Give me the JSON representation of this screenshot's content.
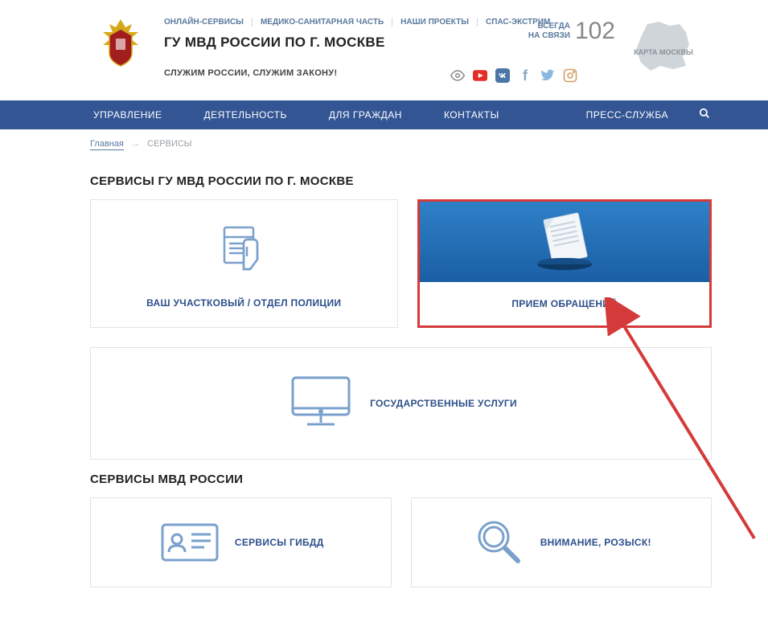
{
  "header": {
    "topnav": [
      "ОНЛАЙН-СЕРВИСЫ",
      "МЕДИКО-САНИТАРНАЯ ЧАСТЬ",
      "НАШИ ПРОЕКТЫ",
      "СПАС-ЭКСТРИМ"
    ],
    "title": "ГУ МВД РОССИИ ПО Г. МОСКВЕ",
    "slogan": "СЛУЖИМ РОССИИ, СЛУЖИМ ЗАКОНУ!",
    "phone_top": "ВСЕГДА",
    "phone_bot": "НА СВЯЗИ",
    "phone": "102",
    "map_caption": "КАРТА МОСКВЫ"
  },
  "nav": [
    "УПРАВЛЕНИЕ",
    "ДЕЯТЕЛЬНОСТЬ",
    "ДЛЯ ГРАЖДАН",
    "КОНТАКТЫ",
    "ПРЕСС-СЛУЖБА"
  ],
  "breadcrumb": {
    "home": "Главная",
    "current": "СЕРВИСЫ"
  },
  "section1_title": "СЕРВИСЫ ГУ МВД РОССИИ ПО Г. МОСКВЕ",
  "card_district": "ВАШ УЧАСТКОВЫЙ / ОТДЕЛ ПОЛИЦИИ",
  "card_appeals": "ПРИЕМ ОБРАЩЕНИЙ",
  "card_gosuslugi": "ГОСУДАРСТВЕННЫЕ УСЛУГИ",
  "section2_title": "СЕРВИСЫ МВД РОССИИ",
  "card_gibdd": "СЕРВИСЫ ГИБДД",
  "card_wanted": "ВНИМАНИЕ, РОЗЫСК!"
}
